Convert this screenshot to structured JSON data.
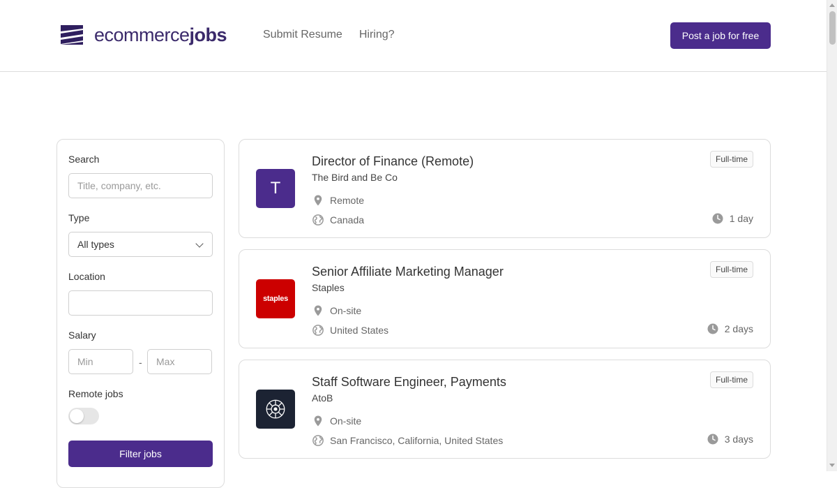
{
  "header": {
    "logo_light": "ecommerce",
    "logo_bold": "jobs",
    "nav": [
      {
        "label": "Submit Resume"
      },
      {
        "label": "Hiring?"
      }
    ],
    "post_button": "Post a job for free"
  },
  "filters": {
    "search_label": "Search",
    "search_placeholder": "Title, company, etc.",
    "type_label": "Type",
    "type_value": "All types",
    "location_label": "Location",
    "salary_label": "Salary",
    "salary_min_placeholder": "Min",
    "salary_separator": "-",
    "salary_max_placeholder": "Max",
    "remote_label": "Remote jobs",
    "remote_on": false,
    "filter_button": "Filter jobs"
  },
  "jobs": [
    {
      "title": "Director of Finance (Remote)",
      "company": "The Bird and Be Co",
      "workplace": "Remote",
      "location": "Canada",
      "type": "Full-time",
      "age": "1 day",
      "logo_letter": "T",
      "logo_color": "#4b2c8c"
    },
    {
      "title": "Senior Affiliate Marketing Manager",
      "company": "Staples",
      "workplace": "On-site",
      "location": "United States",
      "type": "Full-time",
      "age": "2 days",
      "logo_letter": "staples",
      "logo_color": "#cc0000"
    },
    {
      "title": "Staff Software Engineer, Payments",
      "company": "AtoB",
      "workplace": "On-site",
      "location": "San Francisco, California, United States",
      "type": "Full-time",
      "age": "3 days",
      "logo_letter": "",
      "logo_color": "#1c2333"
    }
  ]
}
